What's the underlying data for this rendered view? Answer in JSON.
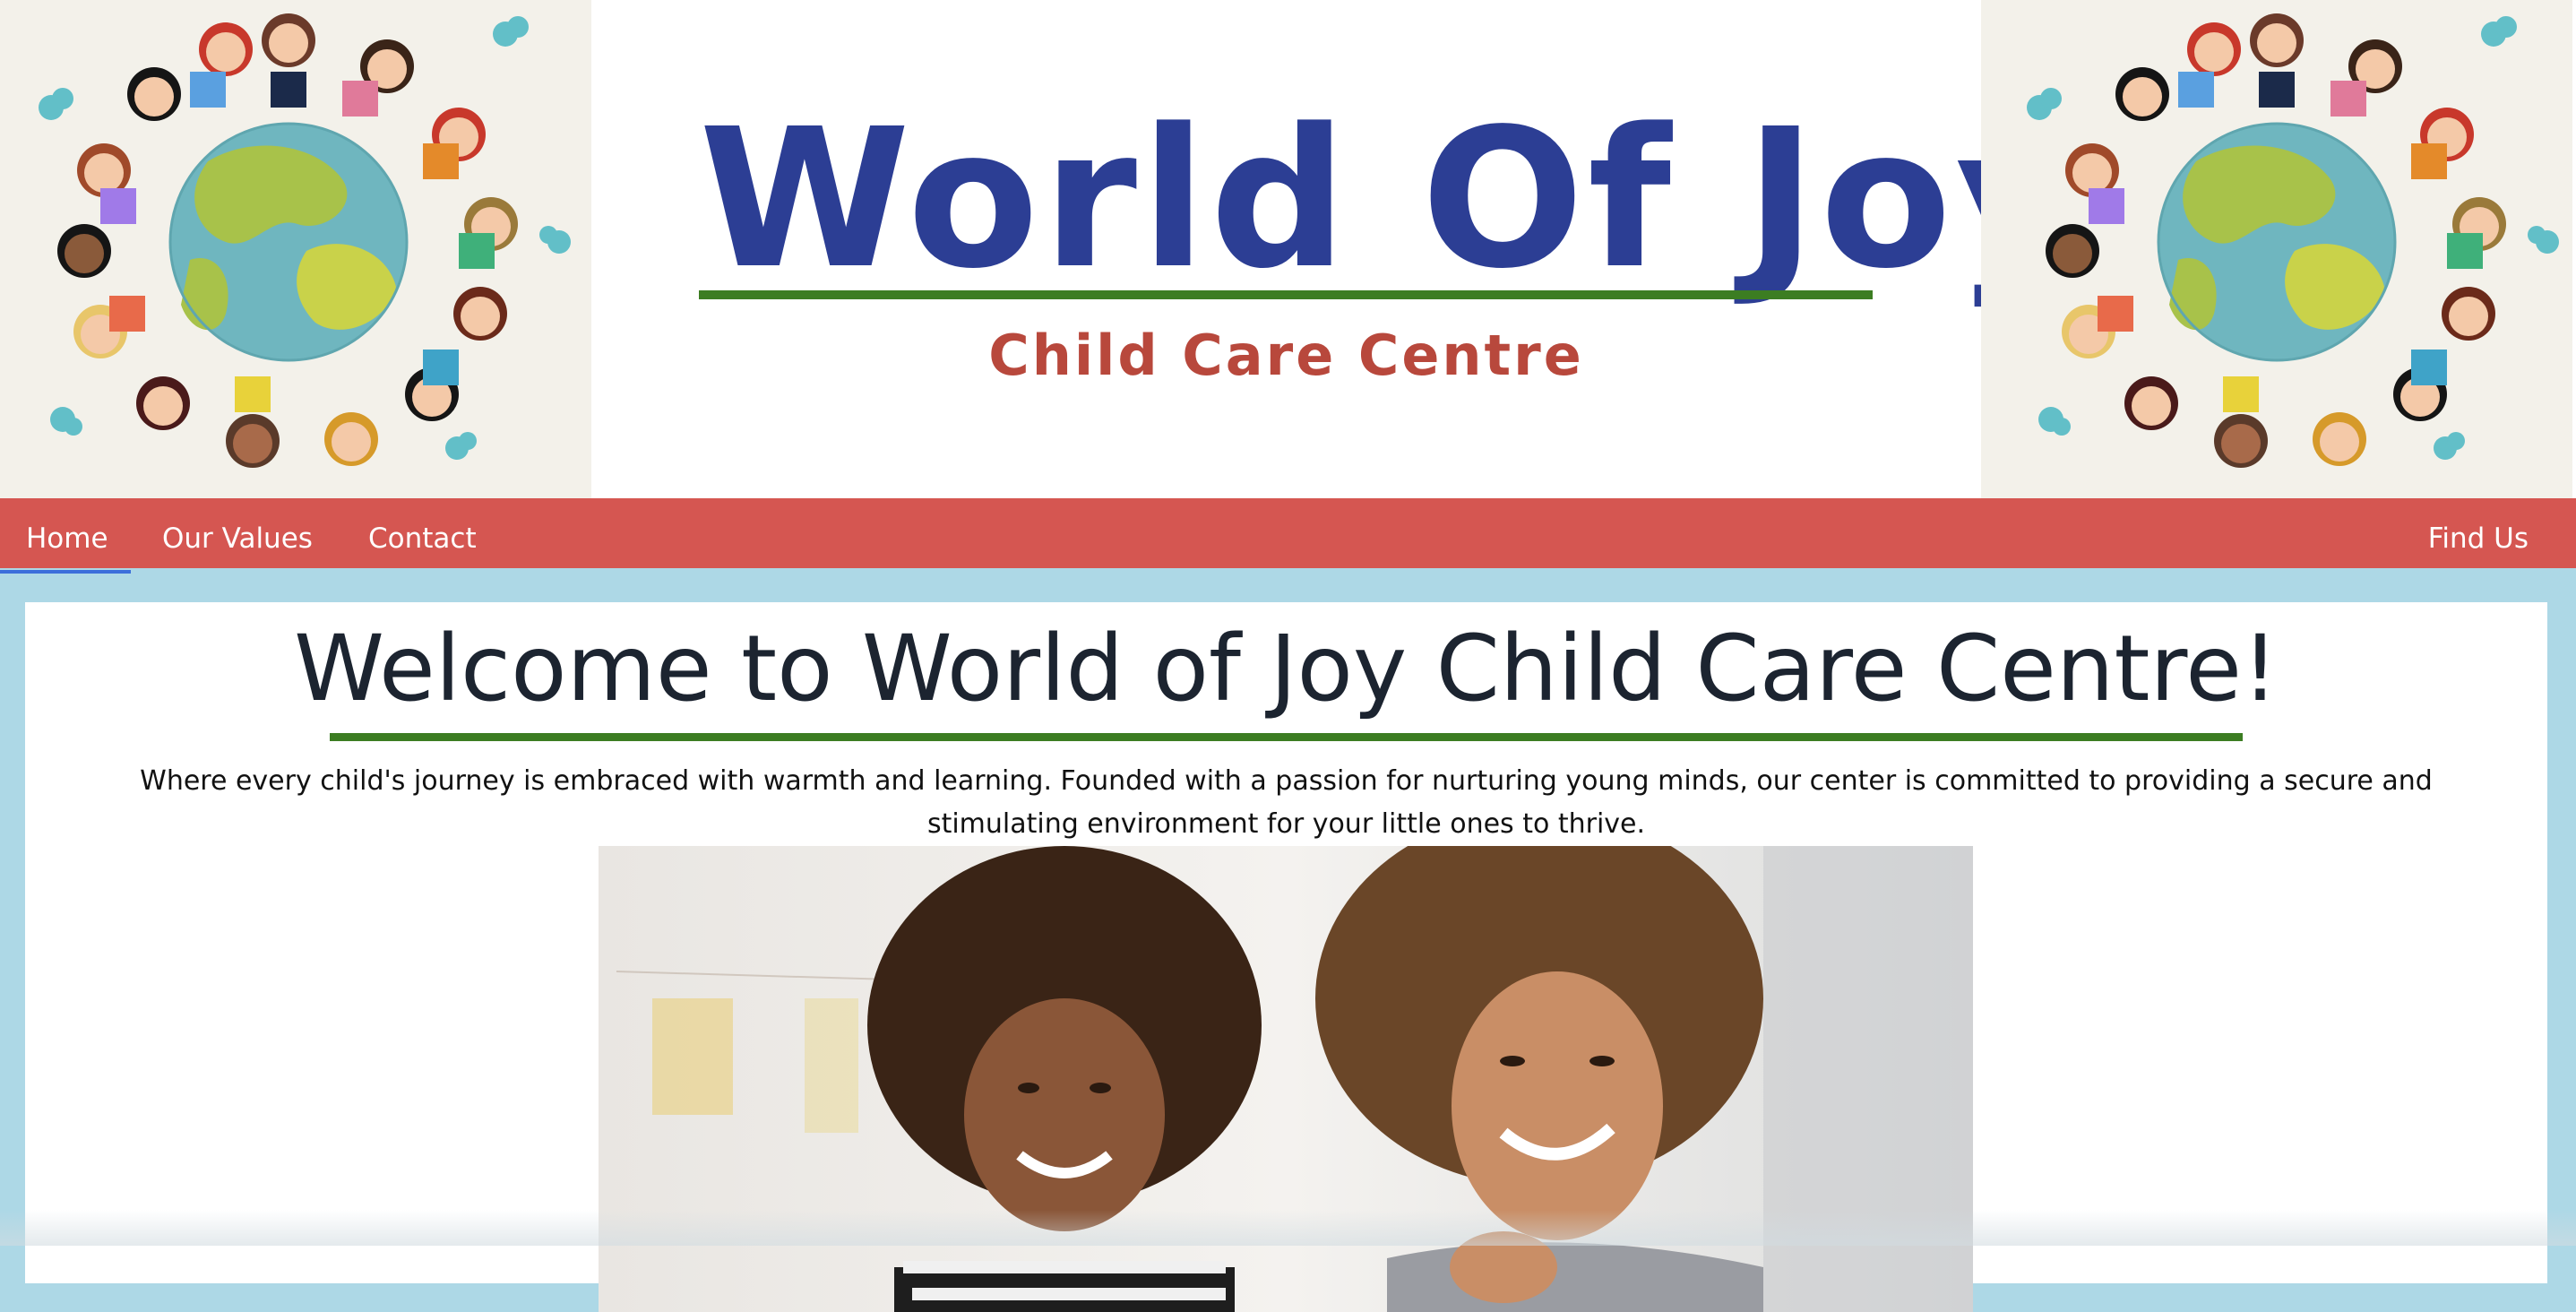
{
  "header": {
    "title": "World Of Joy",
    "subtitle": "Child Care Centre"
  },
  "nav": {
    "home": "Home",
    "values": "Our Values",
    "contact": "Contact",
    "find_us": "Find Us",
    "active": "Home"
  },
  "main": {
    "heading": "Welcome to World of Joy Child Care Centre!",
    "intro": "Where every child's journey is embraced with warmth and learning. Founded with a passion for nurturing young minds, our center is committed to providing a secure and stimulating environment for your little ones to thrive."
  },
  "colors": {
    "page_background": "#ADD8E6",
    "nav_background": "#D55651",
    "title_blue": "#2C3E94",
    "subtitle_red": "#B8483C",
    "underline_green": "#3C7D22",
    "active_indicator": "#3C6FDB"
  },
  "icons": {
    "header_left": "globe-children-illustration",
    "header_right": "globe-children-illustration",
    "hero": "mother-daughter-photo"
  }
}
